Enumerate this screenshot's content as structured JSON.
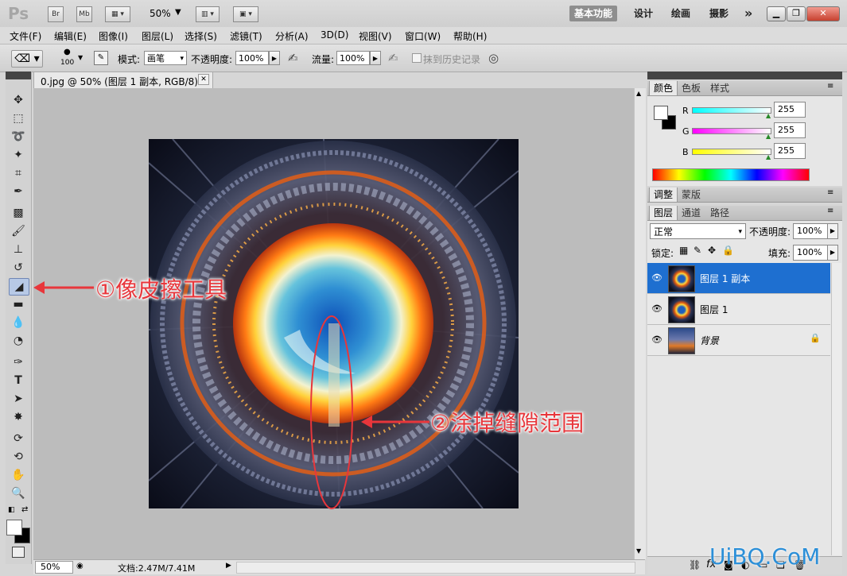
{
  "titlebar": {
    "ps_logo": "Ps",
    "br_label": "Br",
    "mb_label": "Mb",
    "zoom": "50%",
    "workspaces": [
      "基本功能",
      "设计",
      "绘画",
      "摄影"
    ],
    "more": "»"
  },
  "menu": [
    "文件(F)",
    "编辑(E)",
    "图像(I)",
    "图层(L)",
    "选择(S)",
    "滤镜(T)",
    "分析(A)",
    "3D(D)",
    "视图(V)",
    "窗口(W)",
    "帮助(H)"
  ],
  "options": {
    "brush_size": "100",
    "mode_label": "模式:",
    "mode_value": "画笔",
    "opacity_label": "不透明度:",
    "opacity_value": "100%",
    "flow_label": "流量:",
    "flow_value": "100%",
    "history_label": "抹到历史记录"
  },
  "document": {
    "tab_title": "0.jpg @ 50% (图层 1 副本, RGB/8) *",
    "status_zoom": "50%",
    "doc_size": "文档:2.47M/7.41M"
  },
  "color_panel": {
    "tabs": [
      "颜色",
      "色板",
      "样式"
    ],
    "channels": [
      {
        "label": "R",
        "value": "255"
      },
      {
        "label": "G",
        "value": "255"
      },
      {
        "label": "B",
        "value": "255"
      }
    ]
  },
  "adjust_panel": {
    "tabs": [
      "调整",
      "蒙版"
    ]
  },
  "layers_panel": {
    "tabs": [
      "图层",
      "通道",
      "路径"
    ],
    "blend_mode": "正常",
    "opacity_label": "不透明度:",
    "opacity_value": "100%",
    "lock_label": "锁定:",
    "fill_label": "填充:",
    "fill_value": "100%",
    "layers": [
      {
        "name": "图层 1 副本",
        "selected": true
      },
      {
        "name": "图层 1",
        "selected": false
      },
      {
        "name": "背景",
        "selected": false
      }
    ]
  },
  "annotations": {
    "step1": "①像皮擦工具",
    "step2": "②涂掉缝隙范围",
    "accent_color": "#e8363b"
  },
  "watermark": "UiBQ.CoM"
}
